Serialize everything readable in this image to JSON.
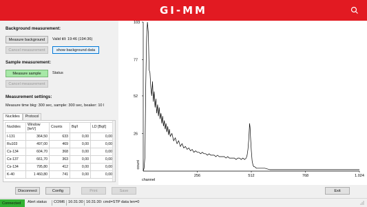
{
  "brand": {
    "logo_text": "GI-MM",
    "title_color": "#e21a22"
  },
  "background": {
    "title": "Background measurement:",
    "measure_label": "Measure background",
    "valid_till": "Valid till: 19:46 (194:36)",
    "cancel_label": "Cancel measurement",
    "show_label": "show background data"
  },
  "sample": {
    "title": "Sample measurement:",
    "measure_label": "Measure sample",
    "status_label": "Status",
    "cancel_label": "Cancel measurement"
  },
  "settings": {
    "title": "Measurement settings:",
    "text": "Measure time bkg: 300 sec, sample: 300 sec, beaker: 10 l"
  },
  "tabs": [
    {
      "label": "Nuclides"
    },
    {
      "label": "Protocol"
    }
  ],
  "nuclides_table": {
    "headers": [
      "Nuclides",
      "Window [keV]",
      "Counts",
      "Bq/l",
      "LD [Bq/l]"
    ],
    "rows": [
      [
        "I-131",
        "364,50",
        "633",
        "0,00",
        "0,00"
      ],
      [
        "Ru103",
        "497,00",
        "469",
        "0,00",
        "0,00"
      ],
      [
        "Cs-134",
        "604,70",
        "368",
        "0,00",
        "0,00"
      ],
      [
        "Cs-137",
        "661,70",
        "363",
        "0,00",
        "0,00"
      ],
      [
        "Cs-134",
        "795,80",
        "412",
        "0,00",
        "0,00"
      ],
      [
        "K-40",
        "1 460,80",
        "741",
        "0,00",
        "0,00"
      ]
    ]
  },
  "buttons": {
    "disconnect": "Disconnect",
    "config": "Config",
    "print": "Print",
    "save": "Save",
    "exit": "Exit"
  },
  "status": {
    "connected": "Connected",
    "alert": "Alert status",
    "port": "COM6",
    "time": "16:31:30",
    "log": "16:31:30: cmd=STP data len=0"
  },
  "chart_data": {
    "type": "line",
    "xlabel": "channel",
    "ylabel": "count",
    "xlim": [
      0,
      1024
    ],
    "ylim": [
      0,
      103
    ],
    "xticks": [
      256,
      512,
      768,
      1024
    ],
    "xtick_labels": [
      "256",
      "512",
      "768",
      "1.024"
    ],
    "yticks": [
      26,
      52,
      77,
      103
    ],
    "ytick_labels": [
      "26",
      "52",
      "77",
      "103"
    ],
    "points": [
      [
        0,
        0
      ],
      [
        4,
        2
      ],
      [
        8,
        10
      ],
      [
        12,
        60
      ],
      [
        16,
        92
      ],
      [
        20,
        103
      ],
      [
        24,
        96
      ],
      [
        28,
        70
      ],
      [
        32,
        68
      ],
      [
        36,
        58
      ],
      [
        40,
        52
      ],
      [
        44,
        62
      ],
      [
        48,
        48
      ],
      [
        52,
        55
      ],
      [
        56,
        44
      ],
      [
        60,
        50
      ],
      [
        64,
        40
      ],
      [
        68,
        46
      ],
      [
        72,
        38
      ],
      [
        76,
        44
      ],
      [
        80,
        36
      ],
      [
        84,
        40
      ],
      [
        88,
        33
      ],
      [
        92,
        38
      ],
      [
        96,
        31
      ],
      [
        100,
        35
      ],
      [
        104,
        29
      ],
      [
        108,
        33
      ],
      [
        112,
        27
      ],
      [
        116,
        31
      ],
      [
        120,
        25
      ],
      [
        124,
        29
      ],
      [
        128,
        24
      ],
      [
        136,
        26
      ],
      [
        144,
        21
      ],
      [
        152,
        23
      ],
      [
        160,
        19
      ],
      [
        168,
        21
      ],
      [
        176,
        17
      ],
      [
        184,
        19
      ],
      [
        192,
        16
      ],
      [
        200,
        17
      ],
      [
        208,
        15
      ],
      [
        216,
        16
      ],
      [
        224,
        14
      ],
      [
        232,
        15
      ],
      [
        240,
        13
      ],
      [
        248,
        14
      ],
      [
        256,
        13
      ],
      [
        264,
        13
      ],
      [
        272,
        12
      ],
      [
        280,
        13
      ],
      [
        288,
        12
      ],
      [
        296,
        12
      ],
      [
        304,
        11
      ],
      [
        312,
        12
      ],
      [
        320,
        11
      ],
      [
        328,
        11
      ],
      [
        336,
        11
      ],
      [
        344,
        10
      ],
      [
        352,
        11
      ],
      [
        360,
        10
      ],
      [
        368,
        10
      ],
      [
        376,
        10
      ],
      [
        384,
        10
      ],
      [
        392,
        9
      ],
      [
        400,
        10
      ],
      [
        408,
        9
      ],
      [
        416,
        9
      ],
      [
        424,
        9
      ],
      [
        432,
        9
      ],
      [
        440,
        8
      ],
      [
        448,
        9
      ],
      [
        456,
        9
      ],
      [
        464,
        8
      ],
      [
        472,
        9
      ],
      [
        480,
        8
      ],
      [
        488,
        9
      ],
      [
        492,
        11
      ],
      [
        496,
        15
      ],
      [
        500,
        22
      ],
      [
        504,
        33
      ],
      [
        506,
        30
      ],
      [
        508,
        24
      ],
      [
        512,
        14
      ],
      [
        516,
        7
      ],
      [
        520,
        4
      ],
      [
        524,
        3
      ],
      [
        528,
        3
      ],
      [
        536,
        2
      ],
      [
        544,
        2
      ],
      [
        560,
        2
      ],
      [
        576,
        2
      ],
      [
        600,
        1
      ],
      [
        640,
        1
      ],
      [
        700,
        1
      ],
      [
        760,
        1
      ],
      [
        820,
        1
      ],
      [
        880,
        1
      ],
      [
        940,
        1
      ],
      [
        1000,
        1
      ],
      [
        1024,
        1
      ]
    ]
  }
}
